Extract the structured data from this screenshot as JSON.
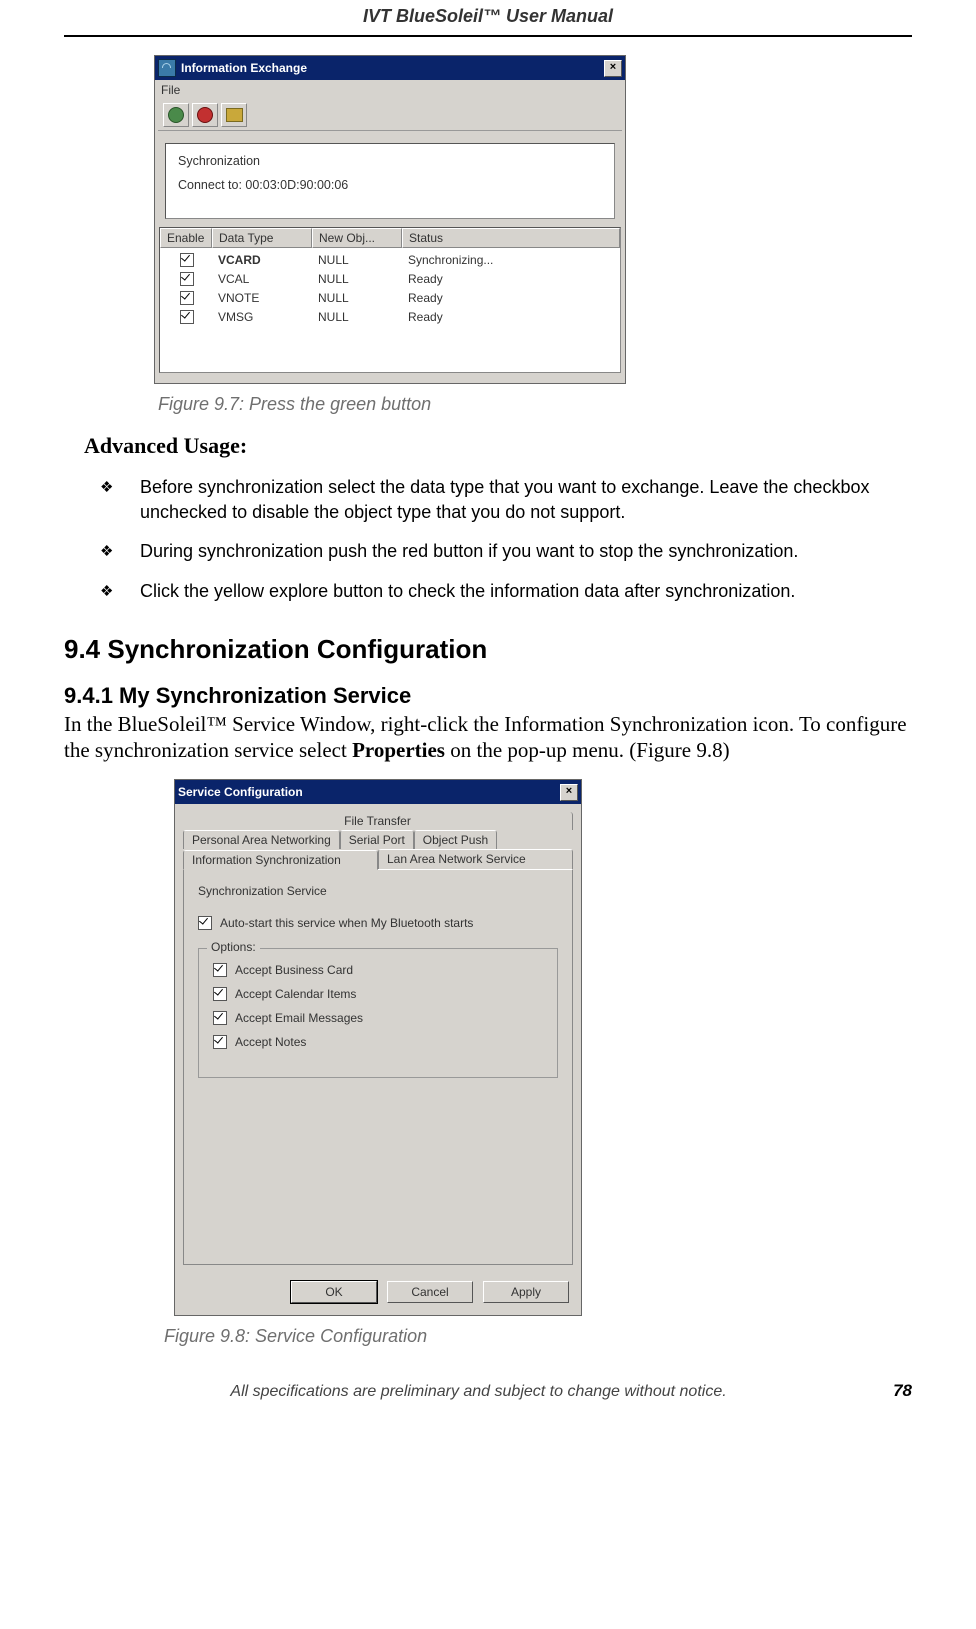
{
  "header": "IVT BlueSoleil™ User Manual",
  "fig97": {
    "title": "Information Exchange",
    "menu_file": "File",
    "panel_label": "Sychronization",
    "connect_label": "Connect to:  00:03:0D:90:00:06",
    "cols": {
      "enable": "Enable",
      "datatype": "Data Type",
      "newobj": "New Obj...",
      "status": "Status"
    },
    "rows": [
      {
        "dt": "VCARD",
        "no": "NULL",
        "st": "Synchronizing...",
        "bold": true
      },
      {
        "dt": "VCAL",
        "no": "NULL",
        "st": "Ready",
        "bold": false
      },
      {
        "dt": "VNOTE",
        "no": "NULL",
        "st": "Ready",
        "bold": false
      },
      {
        "dt": "VMSG",
        "no": "NULL",
        "st": "Ready",
        "bold": false
      }
    ],
    "caption": "Figure 9.7: Press the green button"
  },
  "adv_heading": "Advanced Usage:",
  "bullets": [
    "Before synchronization select the data type that you want to exchange. Leave the checkbox unchecked to disable the object type that you do not support.",
    "During synchronization push the red button if you want to stop the synchronization.",
    "Click the yellow explore button to check the information data after synchronization."
  ],
  "h94": "9.4   Synchronization Configuration",
  "h941": "9.4.1 My Synchronization Service",
  "para_pre": "In the BlueSoleil™ Service Window, right-click the Information Synchronization icon. To configure the synchronization service select ",
  "para_bold": "Properties",
  "para_post": " on the pop-up menu. (Figure 9.8)",
  "fig98": {
    "title": "Service Configuration",
    "tabs_r1": "File Transfer",
    "tabs_r2": [
      "Personal Area Networking",
      "Serial Port",
      "Object Push"
    ],
    "tabs_r3": [
      "Information Synchronization",
      "Lan Area Network Service"
    ],
    "svc_label": "Synchronization Service",
    "autostart": "Auto-start this service when My Bluetooth starts",
    "options_legend": "Options:",
    "options": [
      "Accept Business Card",
      "Accept Calendar Items",
      "Accept Email Messages",
      "Accept Notes"
    ],
    "buttons": {
      "ok": "OK",
      "cancel": "Cancel",
      "apply": "Apply"
    },
    "caption": "Figure 9.8: Service Configuration"
  },
  "footer_text": "All specifications are preliminary and subject to change without notice.",
  "page_num": "78"
}
